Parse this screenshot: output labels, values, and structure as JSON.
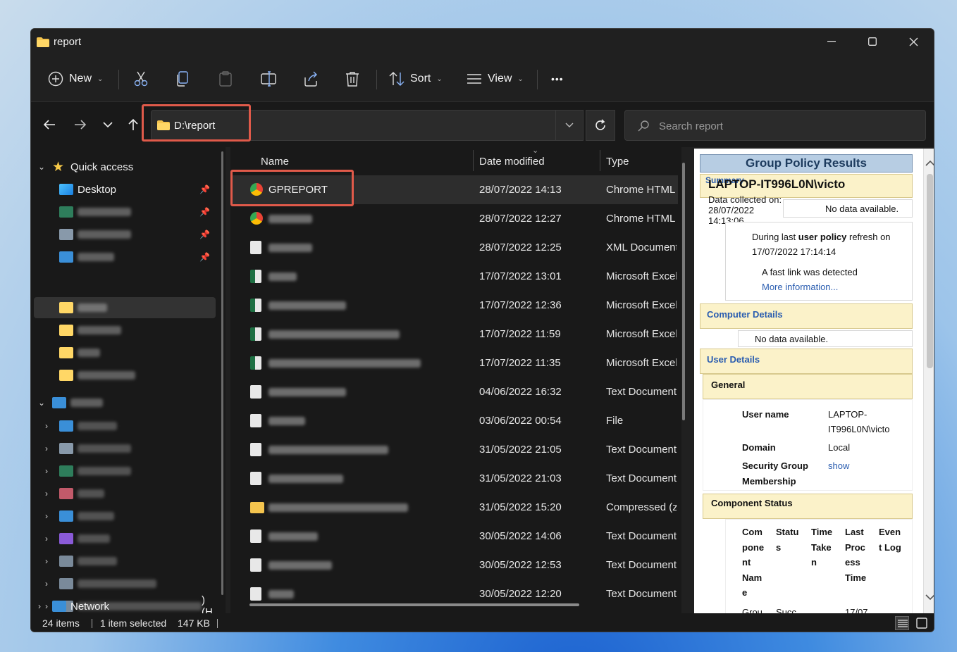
{
  "window": {
    "title": "report",
    "controls": {
      "minimize": "—",
      "maximize": "☐",
      "close": "✕"
    }
  },
  "toolbar": {
    "new_label": "New",
    "sort_label": "Sort",
    "view_label": "View",
    "more_label": "•••"
  },
  "address": {
    "path": "D:\\report",
    "search_placeholder": "Search report"
  },
  "sidebar": {
    "quick_access": "Quick access",
    "desktop": "Desktop",
    "drive_suffix": ") (H",
    "network": "Network"
  },
  "columns": {
    "name": "Name",
    "date": "Date modified",
    "type": "Type"
  },
  "files": [
    {
      "name": "GPREPORT",
      "date": "28/07/2022 14:13",
      "type": "Chrome HTML",
      "icon": "chrome-icon",
      "selected": true
    },
    {
      "name": "",
      "date": "28/07/2022 12:27",
      "type": "Chrome HTML",
      "icon": "chrome-icon"
    },
    {
      "name": "",
      "date": "28/07/2022 12:25",
      "type": "XML Document",
      "icon": "document-icon"
    },
    {
      "name": "",
      "date": "17/07/2022 13:01",
      "type": "Microsoft Excel",
      "icon": "excel-icon"
    },
    {
      "name": "",
      "date": "17/07/2022 12:36",
      "type": "Microsoft Excel",
      "icon": "excel-icon"
    },
    {
      "name": "",
      "date": "17/07/2022 11:59",
      "type": "Microsoft Excel",
      "icon": "excel-icon"
    },
    {
      "name": "",
      "date": "17/07/2022 11:35",
      "type": "Microsoft Excel",
      "icon": "excel-icon"
    },
    {
      "name": "",
      "date": "04/06/2022 16:32",
      "type": "Text Document",
      "icon": "document-icon"
    },
    {
      "name": "",
      "date": "03/06/2022 00:54",
      "type": "File",
      "icon": "document-icon"
    },
    {
      "name": "",
      "date": "31/05/2022 21:05",
      "type": "Text Document",
      "icon": "document-icon"
    },
    {
      "name": "",
      "date": "31/05/2022 21:03",
      "type": "Text Document",
      "icon": "document-icon"
    },
    {
      "name": "",
      "date": "31/05/2022 15:20",
      "type": "Compressed (zi",
      "icon": "zip-folder-icon"
    },
    {
      "name": "",
      "date": "30/05/2022 14:06",
      "type": "Text Document",
      "icon": "document-icon"
    },
    {
      "name": "",
      "date": "30/05/2022 12:53",
      "type": "Text Document",
      "icon": "document-icon"
    },
    {
      "name": "",
      "date": "30/05/2022 12:20",
      "type": "Text Document",
      "icon": "document-icon"
    }
  ],
  "preview": {
    "header": "Group Policy Results",
    "summary_label": "Summary",
    "computer_name": "LAPTOP-IT996L0N\\victo",
    "data_collected_label": "Data collected on:",
    "data_collected_date": "28/07/2022",
    "data_collected_time": "14:13:06",
    "no_data": "No data available.",
    "refresh_prefix": "During last ",
    "refresh_bold": "user policy",
    "refresh_suffix": " refresh on",
    "refresh_time": "17/07/2022 17:14:14",
    "fast_link": "A fast link was detected",
    "more_info": "More information...",
    "computer_details": "Computer Details",
    "no_data_2": "No data available.",
    "user_details": "User Details",
    "general": "General",
    "user_name_label": "User name",
    "user_name_value_1": "LAPTOP-",
    "user_name_value_2": "IT996L0N\\victo",
    "domain_label": "Domain",
    "domain_value": "Local",
    "security_group_label_1": "Security Group",
    "security_group_label_2": "Membership",
    "show_link": "show",
    "component_status": "Component Status",
    "col_component": [
      "Com",
      "pone",
      "nt",
      "Nam",
      "e"
    ],
    "col_status": [
      "Statu",
      "s"
    ],
    "col_time_taken": [
      "Time",
      "Take",
      "n"
    ],
    "col_last_process": [
      "Last",
      "Proc",
      "ess",
      "Time"
    ],
    "col_event_log": [
      "Even",
      "t Log"
    ],
    "partial_row": [
      "Grou",
      "Succ",
      "17/07"
    ]
  },
  "status": {
    "items": "24 items",
    "selected": "1 item selected",
    "size": "147 KB"
  }
}
